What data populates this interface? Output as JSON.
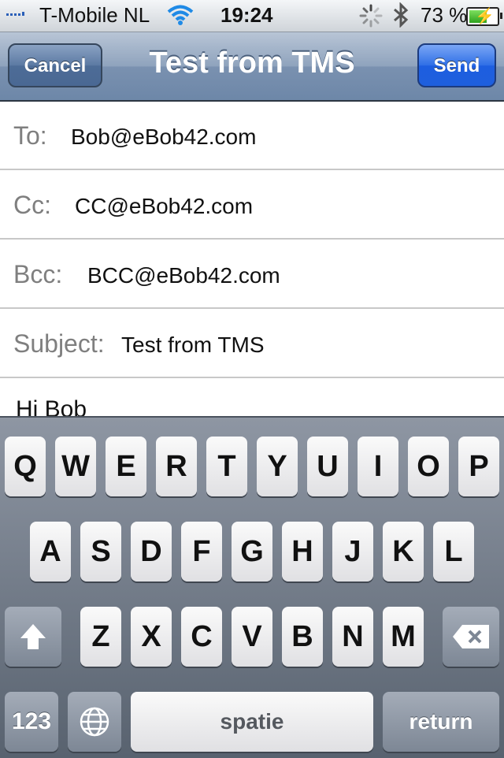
{
  "status": {
    "carrier": "T-Mobile NL",
    "time": "19:24",
    "battery": "73 %",
    "battery_level": 0.73,
    "icons": [
      "signal-icon",
      "wifi-icon",
      "activity-spinner-icon",
      "bluetooth-icon",
      "battery-icon"
    ]
  },
  "nav": {
    "title": "Test from TMS",
    "cancel_label": "Cancel",
    "send_label": "Send",
    "send_color": "#2f6fe6"
  },
  "fields": [
    {
      "label": "To:",
      "value": "Bob@eBob42.com"
    },
    {
      "label": "Cc:",
      "value": "CC@eBob42.com"
    },
    {
      "label": "Bcc:",
      "value": "BCC@eBob42.com"
    },
    {
      "label": "Subject:",
      "value": "Test from TMS"
    }
  ],
  "body": "Hi Bob",
  "keyboard": {
    "row1": [
      "Q",
      "W",
      "E",
      "R",
      "T",
      "Y",
      "U",
      "I",
      "O",
      "P"
    ],
    "row2": [
      "A",
      "S",
      "D",
      "F",
      "G",
      "H",
      "J",
      "K",
      "L"
    ],
    "row3": [
      "Z",
      "X",
      "C",
      "V",
      "B",
      "N",
      "M"
    ],
    "numbers_label": "123",
    "space_label": "spatie",
    "return_label": "return",
    "icons": [
      "shift-icon",
      "delete-icon",
      "globe-icon"
    ]
  }
}
